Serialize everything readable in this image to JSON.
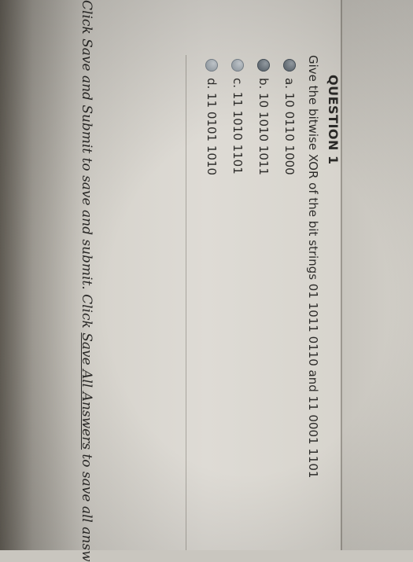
{
  "question": {
    "title": "QUESTION 1",
    "prompt": "Give the bitwise XOR of the bit strings 01 1011 0110 and 11 0001 1101",
    "options": [
      {
        "label": "a. 10 0110 1000",
        "selected": false
      },
      {
        "label": "b. 10 1010 1011",
        "selected": false
      },
      {
        "label": "c. 11 1010 1101",
        "selected": false
      },
      {
        "label": "d. 11 0101 1010",
        "selected": false
      }
    ]
  },
  "footer": {
    "part1": "Click Save and Submit to save and submit. Click ",
    "link_text": "Save All Answers",
    "part2": " to save all answ"
  },
  "colors": {
    "text": "#2d2c2a",
    "radio": "#6f7880"
  }
}
